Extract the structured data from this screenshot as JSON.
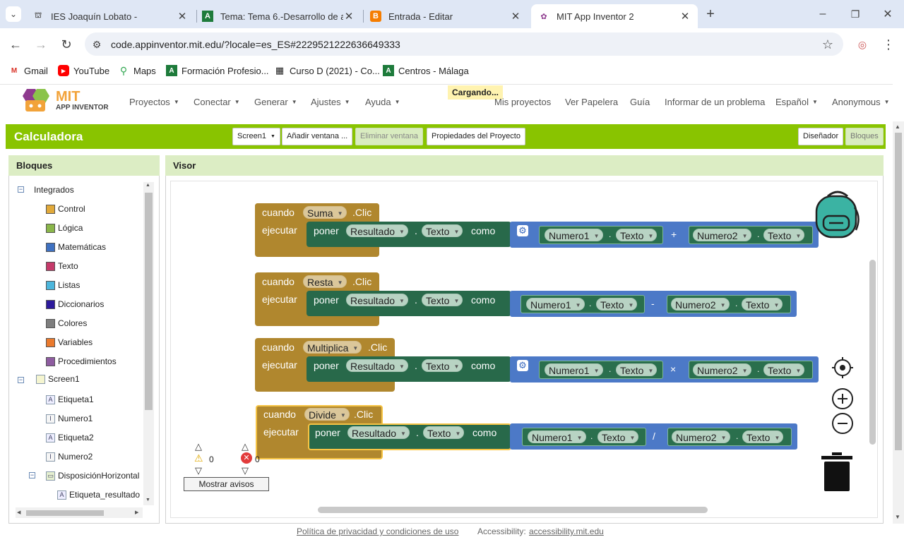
{
  "browser": {
    "tabs": [
      {
        "title": "IES Joaquín Lobato -",
        "active": false
      },
      {
        "title": "Tema: Tema 6.-Desarrollo de ap",
        "active": false
      },
      {
        "title": "Entrada - Editar",
        "active": false
      },
      {
        "title": "MIT App Inventor 2",
        "active": true
      }
    ],
    "url": "code.appinventor.mit.edu/?locale=es_ES#2229521222636649333",
    "bookmarks": [
      "Gmail",
      "YouTube",
      "Maps",
      "Formación Profesio...",
      "Curso D (2021) - Co...",
      "Centros - Málaga"
    ]
  },
  "app": {
    "logo_line1": "MIT",
    "logo_line2": "APP INVENTOR",
    "menus": [
      "Proyectos",
      "Conectar",
      "Generar",
      "Ajustes",
      "Ayuda"
    ],
    "loading": "Cargando...",
    "right_links": [
      "Mis proyectos",
      "Ver Papelera",
      "Guía",
      "Informar de un problema"
    ],
    "language": "Español",
    "user": "Anonymous"
  },
  "project": {
    "name": "Calculadora",
    "screen_select": "Screen1",
    "add_screen": "Añadir ventana ...",
    "remove_screen": "Eliminar ventana",
    "properties": "Propiedades del Proyecto",
    "designer": "Diseñador",
    "blocks": "Bloques"
  },
  "left_panel": {
    "title": "Bloques",
    "builtin": "Integrados",
    "categories": [
      {
        "label": "Control",
        "color": "#e1a93a"
      },
      {
        "label": "Lógica",
        "color": "#8ab64a"
      },
      {
        "label": "Matemáticas",
        "color": "#3f71c1"
      },
      {
        "label": "Texto",
        "color": "#c53a6a"
      },
      {
        "label": "Listas",
        "color": "#4cb6dc"
      },
      {
        "label": "Diccionarios",
        "color": "#2d1a9c"
      },
      {
        "label": "Colores",
        "color": "#7e7e7e"
      },
      {
        "label": "Variables",
        "color": "#ea7a2d"
      },
      {
        "label": "Procedimientos",
        "color": "#8e5ca0"
      }
    ],
    "screen": "Screen1",
    "components": [
      "Etiqueta1",
      "Numero1",
      "Etiqueta2",
      "Numero2"
    ],
    "arrangement": "DisposiciónHorizontal",
    "arrangement_child": "Etiqueta_resultado"
  },
  "viewer": {
    "title": "Visor",
    "kw_when": "cuando",
    "kw_do": "ejecutar",
    "kw_set": "poner",
    "kw_to": "como",
    "event_suffix": ".Clic",
    "dot": ".",
    "result": "Resultado",
    "prop": "Texto",
    "num1": "Numero1",
    "num2": "Numero2",
    "events": [
      {
        "button": "Suma",
        "op": "+"
      },
      {
        "button": "Resta",
        "op": "-"
      },
      {
        "button": "Multiplica",
        "op": "×"
      },
      {
        "button": "Divide",
        "op": "/"
      }
    ],
    "warnings_count": "0",
    "errors_count": "0",
    "show_warnings": "Mostrar avisos"
  },
  "footer": {
    "privacy": "Política de privacidad y condiciones de uso",
    "accessibility_label": "Accessibility:",
    "accessibility_link": "accessibility.mit.edu"
  }
}
